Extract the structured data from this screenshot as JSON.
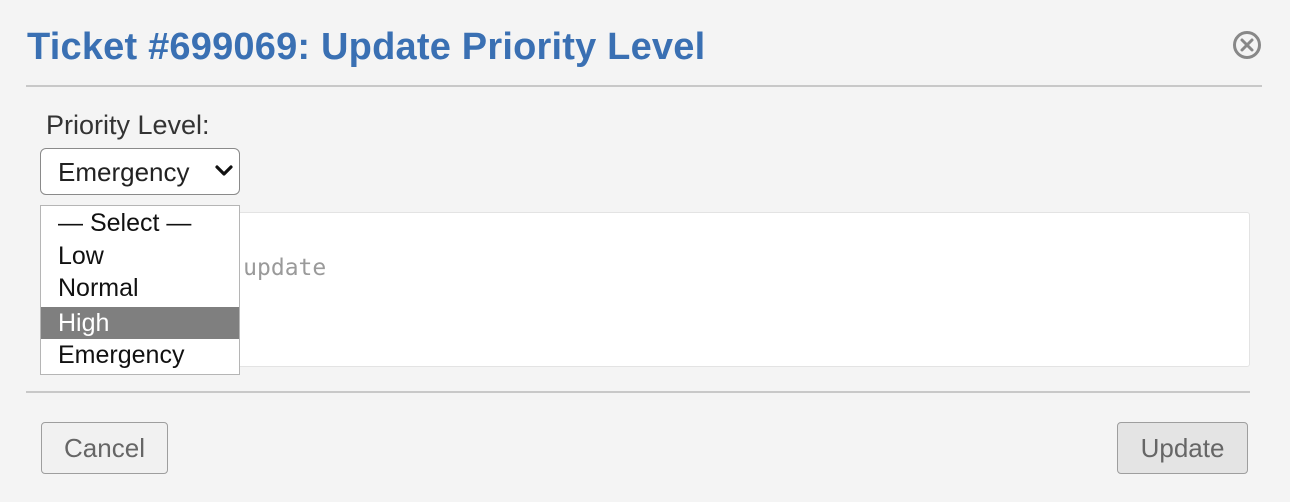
{
  "dialog": {
    "title": "Ticket #699069: Update Priority Level"
  },
  "priority_field": {
    "label": "Priority Level:",
    "selected_value": "Emergency",
    "options": [
      "— Select —",
      "Low",
      "Normal",
      "High",
      "Emergency"
    ],
    "highlighted_option": "High"
  },
  "reason_field": {
    "placeholder_visible_part": "son for the update"
  },
  "buttons": {
    "cancel_label": "Cancel",
    "update_label": "Update"
  },
  "colors": {
    "title": "#3a70b3",
    "highlight": "#7f7f7f",
    "background": "#f4f4f4"
  },
  "icons": {
    "close": "close-circle-icon",
    "select_arrow": "chevron-down-icon"
  }
}
